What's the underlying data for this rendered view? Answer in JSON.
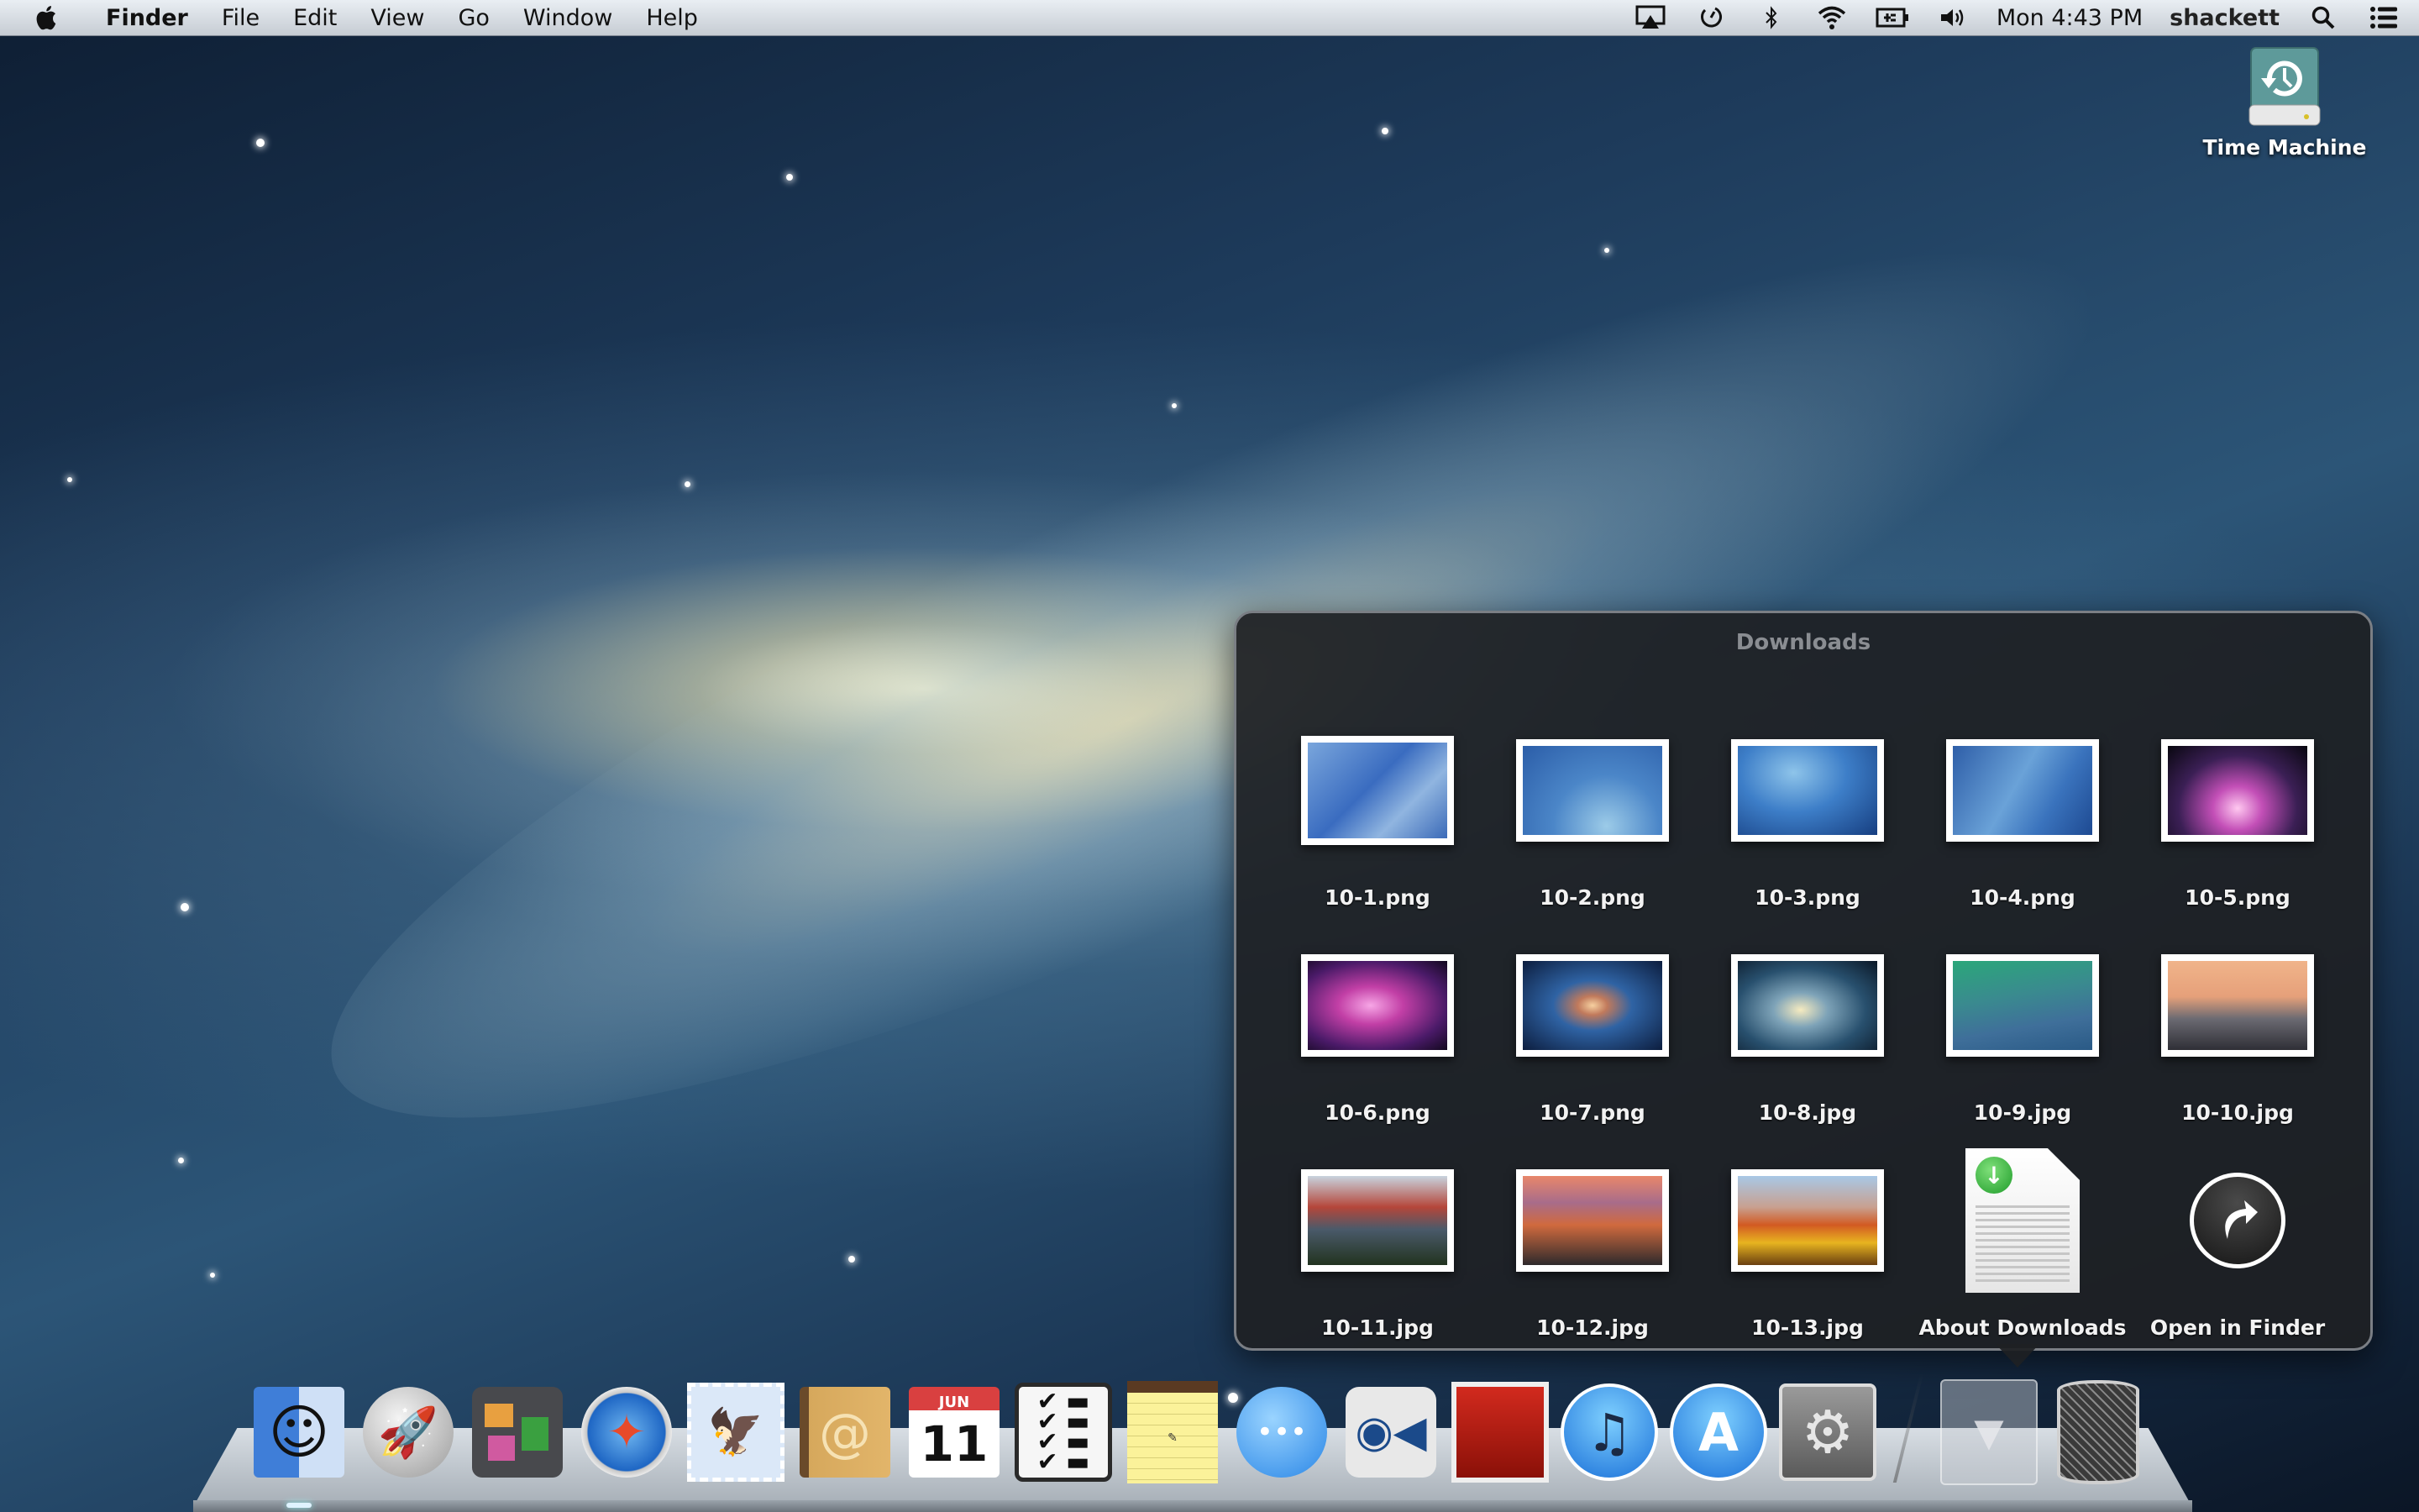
{
  "menubar": {
    "apple_icon": "apple-logo-icon",
    "app_name": "Finder",
    "items": [
      {
        "label": "File"
      },
      {
        "label": "Edit"
      },
      {
        "label": "View"
      },
      {
        "label": "Go"
      },
      {
        "label": "Window"
      },
      {
        "label": "Help"
      }
    ],
    "status_icons": [
      "airplay-icon",
      "time-machine-icon",
      "bluetooth-icon",
      "wifi-icon",
      "battery-icon",
      "volume-icon"
    ],
    "clock": "Mon 4:43 PM",
    "user": "shackett",
    "spotlight_icon": "search-icon",
    "notification_icon": "notification-center-icon"
  },
  "desktop": {
    "icons": [
      {
        "label": "Time Machine",
        "icon": "time-machine-drive-icon"
      }
    ]
  },
  "stack": {
    "title": "Downloads",
    "items": [
      {
        "name": "10-1.png"
      },
      {
        "name": "10-2.png"
      },
      {
        "name": "10-3.png"
      },
      {
        "name": "10-4.png"
      },
      {
        "name": "10-5.png"
      },
      {
        "name": "10-6.png"
      },
      {
        "name": "10-7.png"
      },
      {
        "name": "10-8.jpg"
      },
      {
        "name": "10-9.jpg"
      },
      {
        "name": "10-10.jpg"
      },
      {
        "name": "10-11.jpg"
      },
      {
        "name": "10-12.jpg"
      },
      {
        "name": "10-13.jpg"
      },
      {
        "name": "About Downloads"
      },
      {
        "name": "Open in Finder"
      }
    ]
  },
  "dock": {
    "apps": [
      {
        "name": "Finder",
        "glyph": "☺"
      },
      {
        "name": "Launchpad",
        "glyph": "🚀"
      },
      {
        "name": "Mission Control",
        "glyph": ""
      },
      {
        "name": "Safari",
        "glyph": "✦"
      },
      {
        "name": "Mail",
        "glyph": "🦅"
      },
      {
        "name": "Contacts",
        "glyph": "@"
      },
      {
        "name": "Calendar",
        "month": "JUN",
        "day": "11"
      },
      {
        "name": "Reminders",
        "glyph": "✔ ▬"
      },
      {
        "name": "Notes",
        "glyph": "✎"
      },
      {
        "name": "Messages",
        "glyph": "•••"
      },
      {
        "name": "FaceTime",
        "glyph": "◉◀"
      },
      {
        "name": "Photo Booth",
        "glyph": ""
      },
      {
        "name": "iTunes",
        "glyph": "♫"
      },
      {
        "name": "App Store",
        "glyph": "A"
      },
      {
        "name": "System Preferences",
        "glyph": "⚙"
      }
    ],
    "stacks": [
      {
        "name": "Downloads",
        "glyph": "▼"
      }
    ],
    "trash": {
      "name": "Trash"
    }
  }
}
